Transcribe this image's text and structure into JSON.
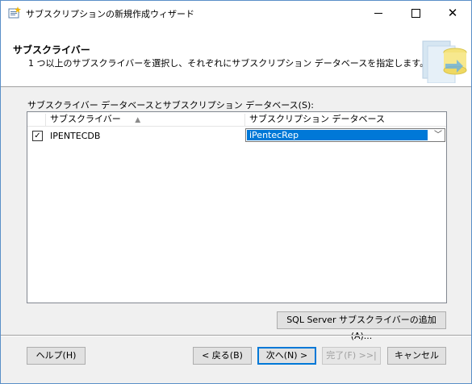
{
  "window": {
    "title": "サブスクリプションの新規作成ウィザード"
  },
  "header": {
    "title": "サブスクライバー",
    "subtitle": "1 つ以上のサブスクライバーを選択し、それぞれにサブスクリプション データベースを指定します。"
  },
  "grid": {
    "label": "サブスクライバー データベースとサブスクリプション データベース(S):",
    "columns": [
      "サブスクライバー",
      "サブスクリプション データベース"
    ],
    "rows": [
      {
        "checked": true,
        "subscriber": "IPENTECDB",
        "database": "iPentecRep"
      }
    ]
  },
  "buttons": {
    "add_subscriber": "SQL Server サブスクライバーの追加(A)...",
    "help": "ヘルプ(H)",
    "back": "< 戻る(B)",
    "next": "次へ(N) >",
    "finish": "完了(F) >>|",
    "cancel": "キャンセル"
  },
  "icons": {
    "title_icon": "wizard-icon",
    "header_art": "database-subscription-icon",
    "checkbox": "checkmark-icon",
    "sort": "sort-asc-icon",
    "dropdown": "chevron-down-icon"
  },
  "colors": {
    "selection": "#0078d7",
    "dialog_bg": "#f0f0f0"
  }
}
